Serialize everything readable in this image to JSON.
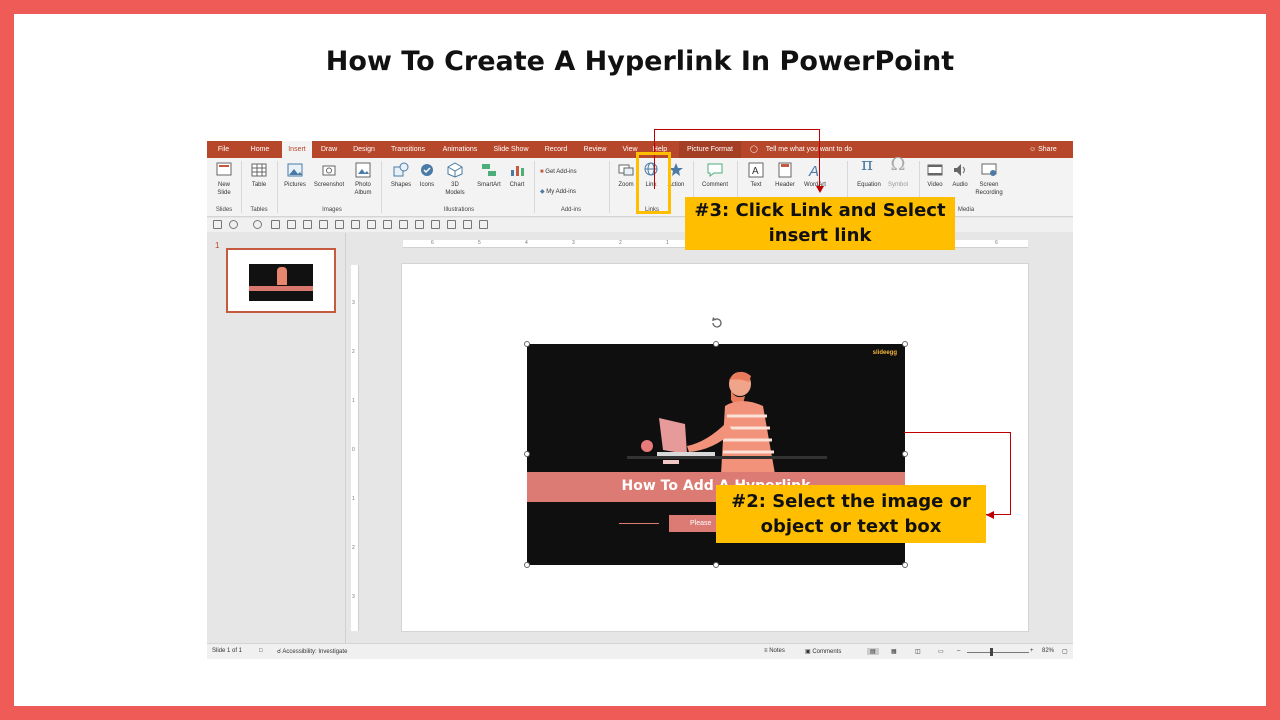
{
  "page_title": "How To Create A Hyperlink In PowerPoint",
  "tabs": [
    "File",
    "Home",
    "Insert",
    "Draw",
    "Design",
    "Transitions",
    "Animations",
    "Slide Show",
    "Record",
    "Review",
    "View",
    "Help",
    "Picture Format"
  ],
  "tell_me": "Tell me what you want to do",
  "share": "Share",
  "ribbon": {
    "new_slide": "New",
    "new_slide_2": "Slide",
    "table": "Table",
    "pictures": "Pictures",
    "screenshot": "Screenshot",
    "photo": "Photo",
    "album": "Album",
    "shapes": "Shapes",
    "icons": "Icons",
    "models_3d": "3D",
    "models_3d_2": "Models",
    "smartart": "SmartArt",
    "chart": "Chart",
    "get_addins": "Get Add-ins",
    "my_addins": "My Add-ins",
    "zoom": "Zoom",
    "link": "Link",
    "action": "Action",
    "comment": "Comment",
    "text": "Text",
    "header": "Header",
    "wordart": "WordArt",
    "equation": "Equation",
    "symbol": "Symbol",
    "video": "Video",
    "audio": "Audio",
    "screen": "Screen",
    "recording": "Recording",
    "pi_glyph": "π",
    "omega_glyph": "Ω",
    "groups": {
      "slides": "Slides",
      "tables": "Tables",
      "images": "Images",
      "illustrations": "Illustrations",
      "addins": "Add-ins",
      "links": "Links",
      "media": "Media"
    }
  },
  "thumbnail": {
    "number": "1"
  },
  "ruler": {
    "top": [
      "6",
      "5",
      "4",
      "3",
      "2",
      "1",
      "0",
      "1",
      "2",
      "3",
      "4",
      "5",
      "6"
    ],
    "left": [
      "3",
      "2",
      "1",
      "0",
      "1",
      "2",
      "3"
    ]
  },
  "slide_image": {
    "logo": "slideegg",
    "banner_text": "How To Add A Hyperlink",
    "button_text": "Please"
  },
  "status": {
    "slide_count": "Slide 1 of 1",
    "accessibility": "Accessibility: Investigate",
    "notes": "Notes",
    "comments": "Comments",
    "zoom_level": "82%"
  },
  "callouts": {
    "step3_line1": "#3: Click Link and Select",
    "step3_line2": "insert link",
    "step2_line1": "#2: Select the image or",
    "step2_line2": "object or text box"
  },
  "colors": {
    "border": "#ef5b57",
    "ribbon_accent": "#b7472a",
    "callout": "#ffbf00",
    "banner": "#dc7b74"
  }
}
